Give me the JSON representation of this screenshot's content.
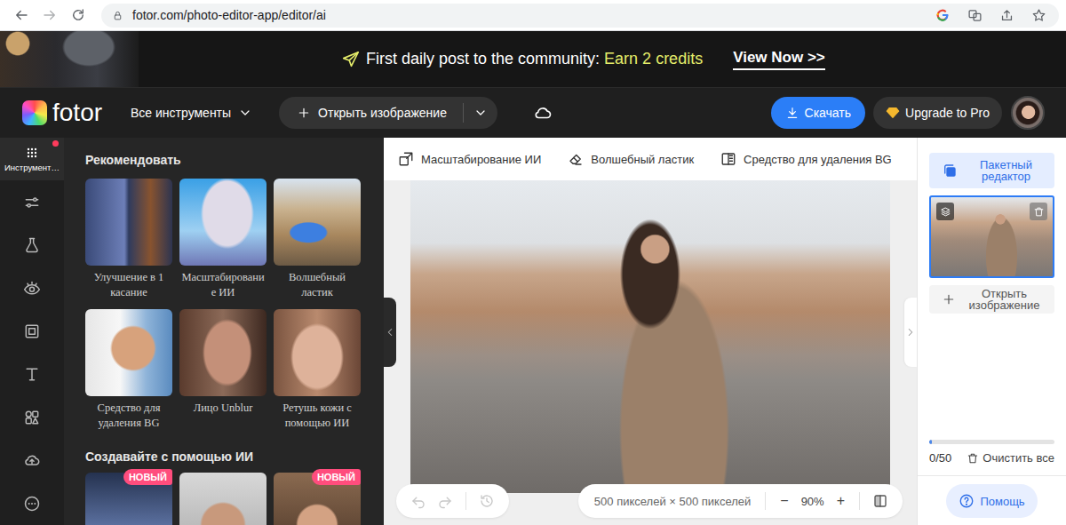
{
  "browser": {
    "url": "fotor.com/photo-editor-app/editor/ai"
  },
  "banner": {
    "text": "First daily post to the community:",
    "highlight": "Earn 2 credits",
    "link": "View Now >>"
  },
  "header": {
    "logo": "fotor",
    "all_tools": "Все инструменты",
    "open_image": "Открыть изображение",
    "download": "Скачать",
    "upgrade": "Upgrade to Pro"
  },
  "rail": {
    "items": [
      {
        "label": "Инструмент…",
        "selected": true,
        "badge": true
      },
      {
        "selected": false
      },
      {
        "selected": false
      },
      {
        "selected": false
      },
      {
        "selected": false
      },
      {
        "selected": false
      },
      {
        "selected": false
      },
      {
        "selected": false
      },
      {
        "selected": false
      }
    ]
  },
  "tool_panel": {
    "sections": [
      {
        "title": "Рекомендовать",
        "cards": [
          {
            "label": "Улучшение в 1 касание"
          },
          {
            "label": "Масштабирование ИИ"
          },
          {
            "label": "Волшебный ластик"
          },
          {
            "label": "Средство для удаления BG"
          },
          {
            "label": "Лицо Unblur"
          },
          {
            "label": "Ретушь кожи с помощью ИИ"
          }
        ]
      },
      {
        "title": "Создавайте с помощью ИИ",
        "cards": [
          {
            "badge": "НОВЫЙ"
          },
          {},
          {
            "badge": "НОВЫЙ"
          }
        ]
      }
    ]
  },
  "canvas": {
    "tools": [
      {
        "label": "Масштабирование ИИ"
      },
      {
        "label": "Волшебный ластик"
      },
      {
        "label": "Средство для удаления BG"
      }
    ],
    "history": [
      {
        "disabled": true
      },
      {
        "disabled": true
      },
      {
        "disabled": true
      }
    ],
    "size": "500 пикселей × 500 пикселей",
    "zoom_out": "−",
    "zoom": "90%",
    "zoom_in": "+"
  },
  "right_panel": {
    "batch": "Пакетный редактор",
    "thumbnail": {
      "selected": true
    },
    "open": "Открыть изображение",
    "progress": {
      "level": 0.02,
      "reading": "0/50"
    },
    "clear": "Очистить все",
    "help": "Помощь"
  }
}
